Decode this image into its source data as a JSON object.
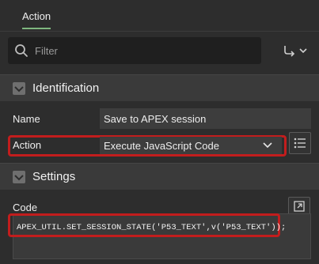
{
  "tab": {
    "label": "Action"
  },
  "search": {
    "placeholder": "Filter",
    "value": ""
  },
  "sections": {
    "identification": {
      "title": "Identification",
      "name_label": "Name",
      "name_value": "Save to APEX session",
      "action_label": "Action",
      "action_value": "Execute JavaScript Code"
    },
    "settings": {
      "title": "Settings",
      "code_label": "Code",
      "code_value": "APEX_UTIL.SET_SESSION_STATE('P53_TEXT',v('P53_TEXT'));"
    }
  },
  "colors": {
    "highlight": "#c21d1d",
    "tab_underline": "#7fb77f",
    "background": "#2d2d2d"
  },
  "icons": [
    "search-icon",
    "goto-icon",
    "chevron-down-icon",
    "collapse-icon",
    "list-icon",
    "expand-icon"
  ]
}
